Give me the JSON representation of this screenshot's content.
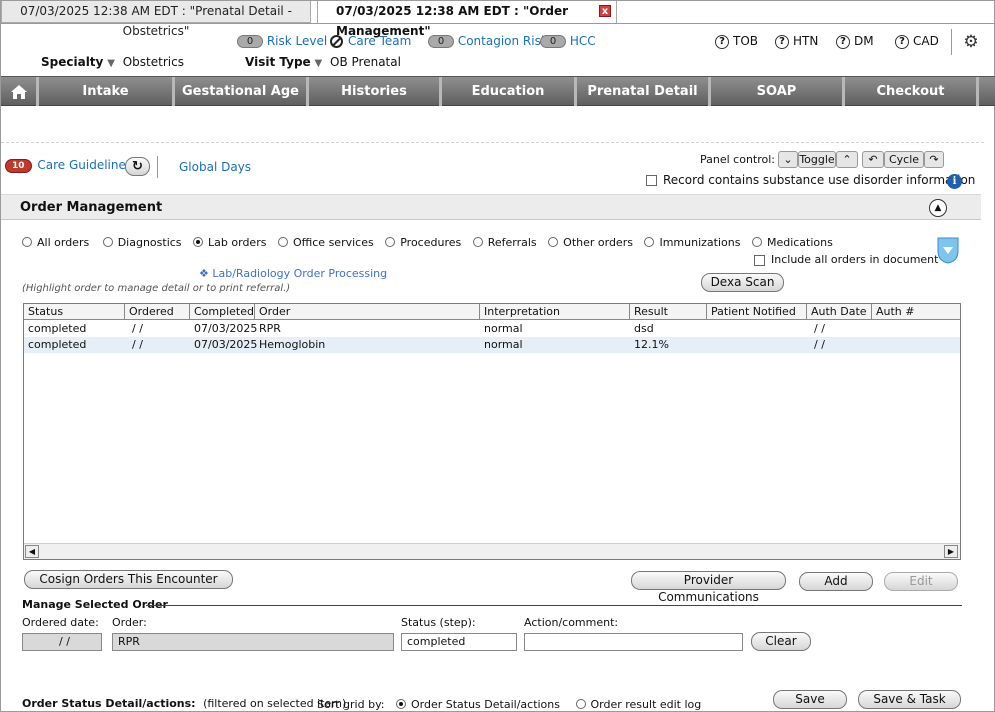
{
  "tabs": [
    {
      "label": "07/03/2025 12:38 AM EDT : \"Prenatal Detail - Obstetrics\""
    },
    {
      "label": "07/03/2025 12:38 AM EDT : \"Order Management\"",
      "close": "x"
    }
  ],
  "header": {
    "risk_level": {
      "count": "0",
      "label": "Risk Level"
    },
    "care_team": "Care Team",
    "contagion_risk": {
      "count": "0",
      "label": "Contagion Risk"
    },
    "hcc": {
      "count": "0",
      "label": "HCC"
    },
    "specialty_label": "Specialty",
    "specialty_value": "Obstetrics",
    "visit_type_label": "Visit Type",
    "visit_type_value": "OB Prenatal",
    "indicators": [
      "TOB",
      "HTN",
      "DM",
      "CAD"
    ],
    "help_glyph": "?"
  },
  "nav": [
    "Intake",
    "Gestational Age",
    "Histories",
    "Education",
    "Prenatal Detail",
    "SOAP",
    "Checkout"
  ],
  "guidelines": {
    "count": "10",
    "label": "Care Guidelines",
    "global_days": "Global Days"
  },
  "panel_control": {
    "label": "Panel control:",
    "toggle": "Toggle",
    "cycle": "Cycle"
  },
  "substance_label": "Record contains substance use disorder information",
  "section_title": "Order Management",
  "filters": {
    "options": [
      "All orders",
      "Diagnostics",
      "Lab orders",
      "Office services",
      "Procedures",
      "Referrals",
      "Other orders",
      "Immunizations",
      "Medications"
    ],
    "selected": "Lab orders",
    "include_all": "Include all orders in document"
  },
  "processing_link": "Lab/Radiology Order Processing",
  "hint": "(Highlight order to manage detail or to print referral.)",
  "dexa_button": "Dexa Scan",
  "grid": {
    "columns": [
      "Status",
      "Ordered",
      "Completed",
      "Order",
      "Interpretation",
      "Result",
      "Patient Notified",
      "Auth Date",
      "Auth #"
    ],
    "rows": [
      [
        "completed",
        " /  /",
        "07/03/2025",
        "RPR",
        "normal",
        "dsd",
        "",
        " /  /",
        ""
      ],
      [
        "completed",
        " /  /",
        "07/03/2025",
        "Hemoglobin",
        "normal",
        "12.1%",
        "",
        " /  /",
        ""
      ]
    ]
  },
  "buttons": {
    "cosign": "Cosign Orders This Encounter",
    "provider_comm": "Provider Communications",
    "add": "Add",
    "edit": "Edit",
    "clear": "Clear",
    "save": "Save",
    "save_task": "Save & Task"
  },
  "manage": {
    "title": "Manage Selected Order",
    "ordered_date_label": "Ordered date:",
    "ordered_date_value": " /  /",
    "order_label": "Order:",
    "order_value": "RPR",
    "status_label": "Status (step):",
    "status_value": "completed",
    "action_label": "Action/comment:",
    "action_value": ""
  },
  "footer": {
    "detail_label": "Order Status Detail/actions:",
    "filter_note": "(filtered on selected item)",
    "sort_label": "Sort grid by:",
    "sort_options": [
      "Order Status Detail/actions",
      "Order result edit log"
    ],
    "sort_selected": "Order Status Detail/actions"
  },
  "colors": {
    "link": "#1a6fb8",
    "nav": "#6f6f6f",
    "badge_red": "#c0392b",
    "selected_row": "#e6eef8"
  }
}
